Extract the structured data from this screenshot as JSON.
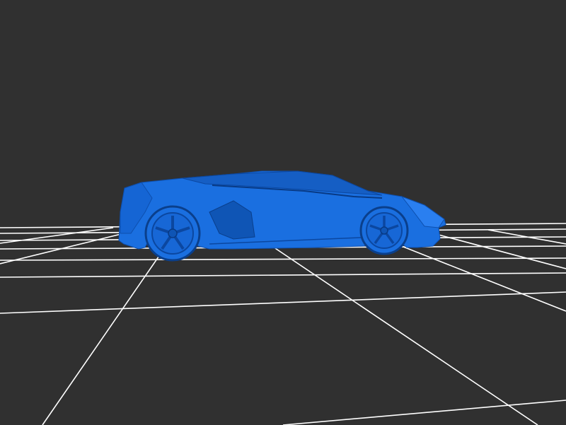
{
  "scene": {
    "background_color": "#303030",
    "grid_color": "#ffffff",
    "model_color": "#1a6fe0",
    "model": "sports-car",
    "view": "side",
    "grid": true
  }
}
